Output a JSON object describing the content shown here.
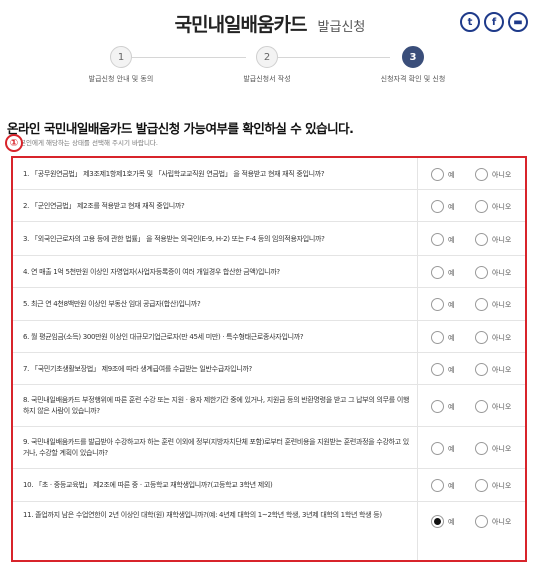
{
  "header": {
    "title": "국민내일배움카드",
    "subtitle": "발급신청",
    "share": [
      {
        "icon": "twitter-icon",
        "glyph": "t"
      },
      {
        "icon": "facebook-icon",
        "glyph": "f"
      },
      {
        "icon": "message-icon",
        "glyph": "▬"
      }
    ]
  },
  "steps": [
    {
      "num": "1",
      "label": "발급신청 안내 및 동의",
      "active": false
    },
    {
      "num": "2",
      "label": "발급신청서 작성",
      "active": false
    },
    {
      "num": "3",
      "label": "신청자격 확인 및 신청",
      "active": true
    }
  ],
  "main": {
    "heading": "온라인 국민내일배움카드 발급신청 가능여부를 확인하실 수 있습니다.",
    "subnote": "본인에게 해당하는 상태를 선택해 주시기 바랍니다.",
    "marker": "①",
    "yes_label": "예",
    "no_label": "아니오"
  },
  "questions": [
    {
      "text": "1. 「공무원연금법」 제3조제1항제1호가목 및 「사립학교교직원 연금법」 을 적용받고 현재 재직 중입니까?",
      "selected": ""
    },
    {
      "text": "2. 「군인연금법」 제2조를 적용받고 현재 재직 중입니까?",
      "selected": ""
    },
    {
      "text": "3. 「외국인근로자의 고용 등에 관한 법률」 을 적용받는 외국인(E-9, H-2) 또는 F-4 등의 임의적용자입니까?",
      "selected": ""
    },
    {
      "text": "4. 연 매출 1억 5천만원 이상인 자영업자(사업자등록증이 여러 개일경우 합산한 금액)입니까?",
      "selected": ""
    },
    {
      "text": "5. 최근 연 4천8백만원 이상인 부동산 임대 공급자(합산)입니까?",
      "selected": ""
    },
    {
      "text": "6. 월 평균임금(소득) 300만원 이상인 대규모기업근로자(만 45세 미만) · 특수형태근로종사자입니까?",
      "selected": ""
    },
    {
      "text": "7. 「국민기초생활보장법」 제9조에 따라 생계급여를 수급받는 일반수급자입니까?",
      "selected": ""
    },
    {
      "text": "8. 국민내일배움카드 부정행위에 따른 훈련 수강 또는 지원 · 융자 제한기간 중에 있거나, 지원금 등의 반환명령을 받고 그 납부의 의무를 이행하지 않은 사람이 있습니까?",
      "selected": ""
    },
    {
      "text": "9. 국민내일배움카드를 발급받아 수강하고자 하는 훈련 이외에 정부(지방자치단체 포함)로부터 훈련비용을 지원받는 훈련과정을 수강하고 있거나, 수강할 계획이 있습니까?",
      "selected": ""
    },
    {
      "text": "10. 「초 · 중등교육법」 제2조에 따른 중 · 고등학교 재학생입니까?(고등학교 3학년 제외)",
      "selected": ""
    },
    {
      "text": "11. 졸업까지 남은 수업연한이 2년 이상인 대학(원) 재학생입니까?(예: 4년제 대학의 1~2학년 학생, 3년제 대학의 1학년 학생 등)",
      "selected": "yes"
    }
  ]
}
